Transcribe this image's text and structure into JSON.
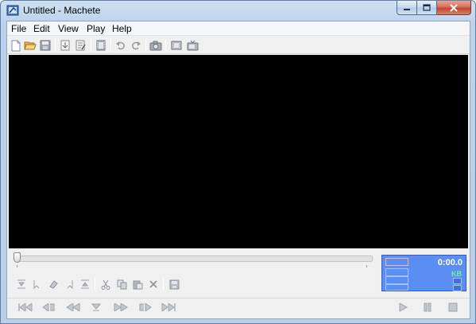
{
  "window": {
    "title": "Untitled - Machete",
    "accent": "#b9cfe7"
  },
  "menu": [
    "File",
    "Edit",
    "View",
    "Play",
    "Help"
  ],
  "toolbar": {
    "icons": [
      "new-file-icon",
      "open-folder-icon",
      "save-icon",
      "import-icon",
      "properties-icon",
      "film-icon",
      "undo-icon",
      "redo-icon",
      "camera-icon",
      "frame-icon",
      "tv-icon"
    ]
  },
  "edit_toolbar": {
    "icons": [
      "mark-in-icon",
      "mark-cursor-icon",
      "eraser-icon",
      "mark-end-icon",
      "mark-out-icon",
      "cut-icon",
      "copy-icon",
      "paste-icon",
      "delete-icon",
      "save-selection-icon"
    ]
  },
  "transport": {
    "icons": [
      "skip-to-start-icon",
      "previous-mark-icon",
      "rewind-icon",
      "go-to-cursor-icon",
      "fast-forward-icon",
      "next-mark-icon",
      "skip-to-end-icon",
      "play-icon",
      "pause-icon",
      "stop-icon"
    ]
  },
  "display": {
    "time": "0:00.0",
    "unit": "KB",
    "colors": {
      "panel": "#5b8ef2",
      "kb": "#74f0a2"
    }
  },
  "seek": {
    "position": 0
  }
}
